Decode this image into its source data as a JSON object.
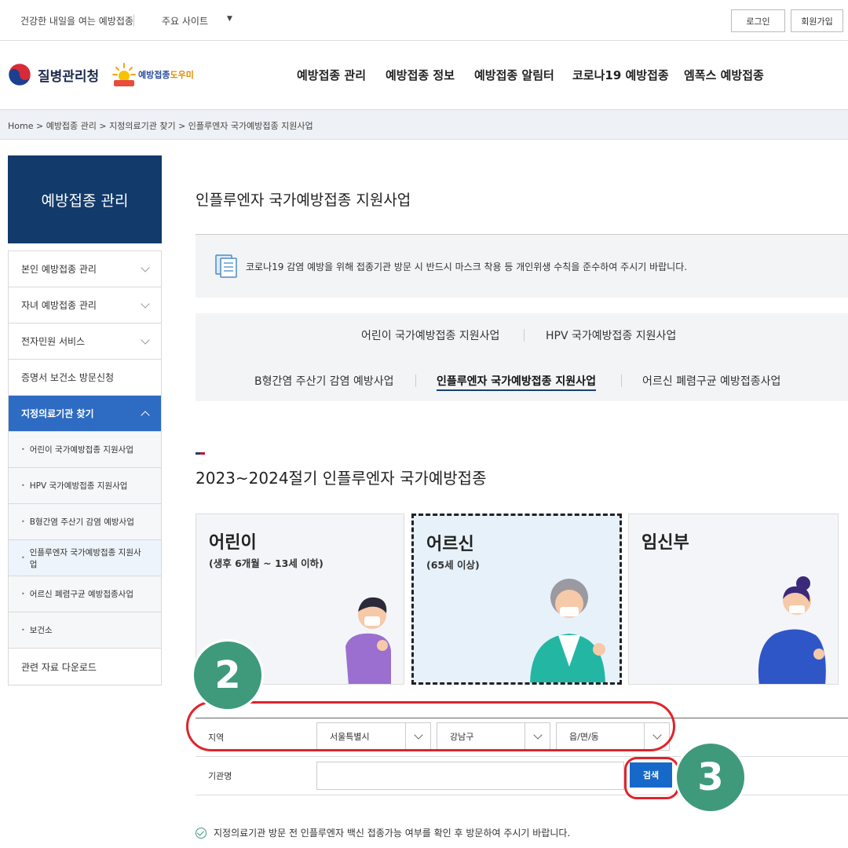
{
  "util": {
    "slogan": "건강한 내일을 여는 예방접종",
    "sites": "주요 사이트",
    "login": "로그인",
    "signup": "회원가입"
  },
  "header": {
    "agency": "질병관리청",
    "helper_a": "예방접종",
    "helper_b": "도우미",
    "nav": [
      "예방접종 관리",
      "예방접종 정보",
      "예방접종 알림터",
      "코로나19 예방접종",
      "엠폭스 예방접종"
    ]
  },
  "breadcrumb": "Home  >  예방접종 관리  >  지정의료기관 찾기  >  인플루엔자 국가예방접종 지원사업",
  "sidebar": {
    "title": "예방접종 관리",
    "items": [
      "본인 예방접종 관리",
      "자녀 예방접종 관리",
      "전자민원 서비스",
      "증명서 보건소 방문신청",
      "지정의료기관 찾기"
    ],
    "subitems": [
      "어린이 국가예방접종 지원사업",
      "HPV 국가예방접종 지원사업",
      "B형간염 주산기 감염 예방사업",
      "인플루엔자 국가예방접종 지원사업",
      "어르신 폐렴구균 예방접종사업",
      "보건소"
    ],
    "download": "관련 자료 다운로드"
  },
  "main": {
    "title": "인플루엔자 국가예방접종 지원사업",
    "notice": "코로나19 감염 예방을 위해 접종기관 방문 시 반드시 마스크 착용 등 개인위생 수칙을 준수하여 주시기 바랍니다.",
    "tabs": [
      "어린이 국가예방접종 지원사업",
      "HPV 국가예방접종 지원사업",
      "B형간염 주산기 감염 예방사업",
      "인플루엔자 국가예방접종 지원사업",
      "어르신 폐렴구균 예방접종사업"
    ],
    "section_title": "2023~2024절기 인플루엔자 국가예방접종",
    "cards": [
      {
        "title": "어린이",
        "subtitle": "(생후 6개월 ~ 13세 이하)"
      },
      {
        "title": "어르신",
        "subtitle": "(65세 이상)"
      },
      {
        "title": "임신부",
        "subtitle": ""
      }
    ]
  },
  "search": {
    "region_label": "지역",
    "city": "서울특별시",
    "district": "강남구",
    "town": "읍/면/동",
    "org_label": "기관명",
    "org_value": "",
    "button": "검색"
  },
  "steps": [
    "2",
    "3"
  ],
  "info_text": "지정의료기관 방문 전 인플루엔자 백신 접종가능 여부를 확인 후 방문하여 주시기 바랍니다.",
  "colors": {
    "navy": "#123a6b",
    "sidebar_active": "#2e6bc2",
    "search_button": "#1669c9",
    "highlight_red": "#e0232a",
    "step_badge": "#3e9a7a"
  }
}
